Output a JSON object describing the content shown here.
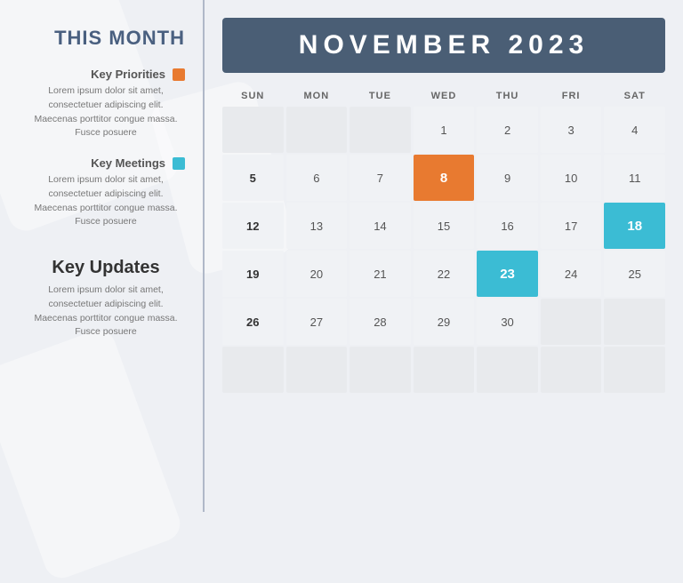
{
  "background": {
    "color": "#eef0f4"
  },
  "sidebar": {
    "title": "THIS MONTH",
    "key_priorities_label": "Key Priorities",
    "key_priorities_color": "#e87a30",
    "key_priorities_text": "Lorem ipsum dolor sit amet, consectetuer adipiscing elit. Maecenas porttitor congue massa. Fusce posuere",
    "key_meetings_label": "Key Meetings",
    "key_meetings_color": "#3bbcd4",
    "key_meetings_text": "Lorem ipsum dolor sit amet, consectetuer adipiscing elit. Maecenas porttitor congue massa. Fusce posuere",
    "key_updates_title": "Key Updates",
    "key_updates_text": "Lorem ipsum dolor sit amet, consectetuer adipiscing elit. Maecenas porttitor congue massa. Fusce posuere"
  },
  "calendar": {
    "month": "NOVEMBER",
    "year": "2023",
    "header_text": "NOVEMBER 2023",
    "days_of_week": [
      "SUN",
      "MON",
      "TUE",
      "WED",
      "THU",
      "FRI",
      "SAT"
    ],
    "weeks": [
      [
        {
          "num": "",
          "type": "empty"
        },
        {
          "num": "",
          "type": "empty"
        },
        {
          "num": "",
          "type": "empty"
        },
        {
          "num": "",
          "type": "empty"
        },
        {
          "num": "1",
          "type": "normal"
        },
        {
          "num": "2",
          "type": "normal"
        },
        {
          "num": "3",
          "type": "normal"
        },
        {
          "num": "4",
          "type": "normal"
        }
      ],
      [
        {
          "num": "5",
          "type": "bold"
        },
        {
          "num": "6",
          "type": "normal"
        },
        {
          "num": "7",
          "type": "normal"
        },
        {
          "num": "8",
          "type": "highlight-orange"
        },
        {
          "num": "9",
          "type": "normal"
        },
        {
          "num": "10",
          "type": "normal"
        },
        {
          "num": "11",
          "type": "normal"
        }
      ],
      [
        {
          "num": "12",
          "type": "bold"
        },
        {
          "num": "13",
          "type": "normal"
        },
        {
          "num": "14",
          "type": "normal"
        },
        {
          "num": "15",
          "type": "normal"
        },
        {
          "num": "16",
          "type": "normal"
        },
        {
          "num": "17",
          "type": "normal"
        },
        {
          "num": "18",
          "type": "highlight-blue"
        }
      ],
      [
        {
          "num": "19",
          "type": "bold"
        },
        {
          "num": "20",
          "type": "normal"
        },
        {
          "num": "21",
          "type": "normal"
        },
        {
          "num": "22",
          "type": "normal"
        },
        {
          "num": "23",
          "type": "highlight-blue"
        },
        {
          "num": "24",
          "type": "normal"
        },
        {
          "num": "25",
          "type": "normal"
        }
      ],
      [
        {
          "num": "26",
          "type": "bold"
        },
        {
          "num": "27",
          "type": "normal"
        },
        {
          "num": "28",
          "type": "normal"
        },
        {
          "num": "29",
          "type": "normal"
        },
        {
          "num": "30",
          "type": "normal"
        },
        {
          "num": "",
          "type": "empty"
        },
        {
          "num": "",
          "type": "empty"
        }
      ],
      [
        {
          "num": "",
          "type": "empty"
        },
        {
          "num": "",
          "type": "empty"
        },
        {
          "num": "",
          "type": "empty"
        },
        {
          "num": "",
          "type": "empty"
        },
        {
          "num": "",
          "type": "empty"
        },
        {
          "num": "",
          "type": "empty"
        },
        {
          "num": "",
          "type": "empty"
        }
      ]
    ]
  }
}
